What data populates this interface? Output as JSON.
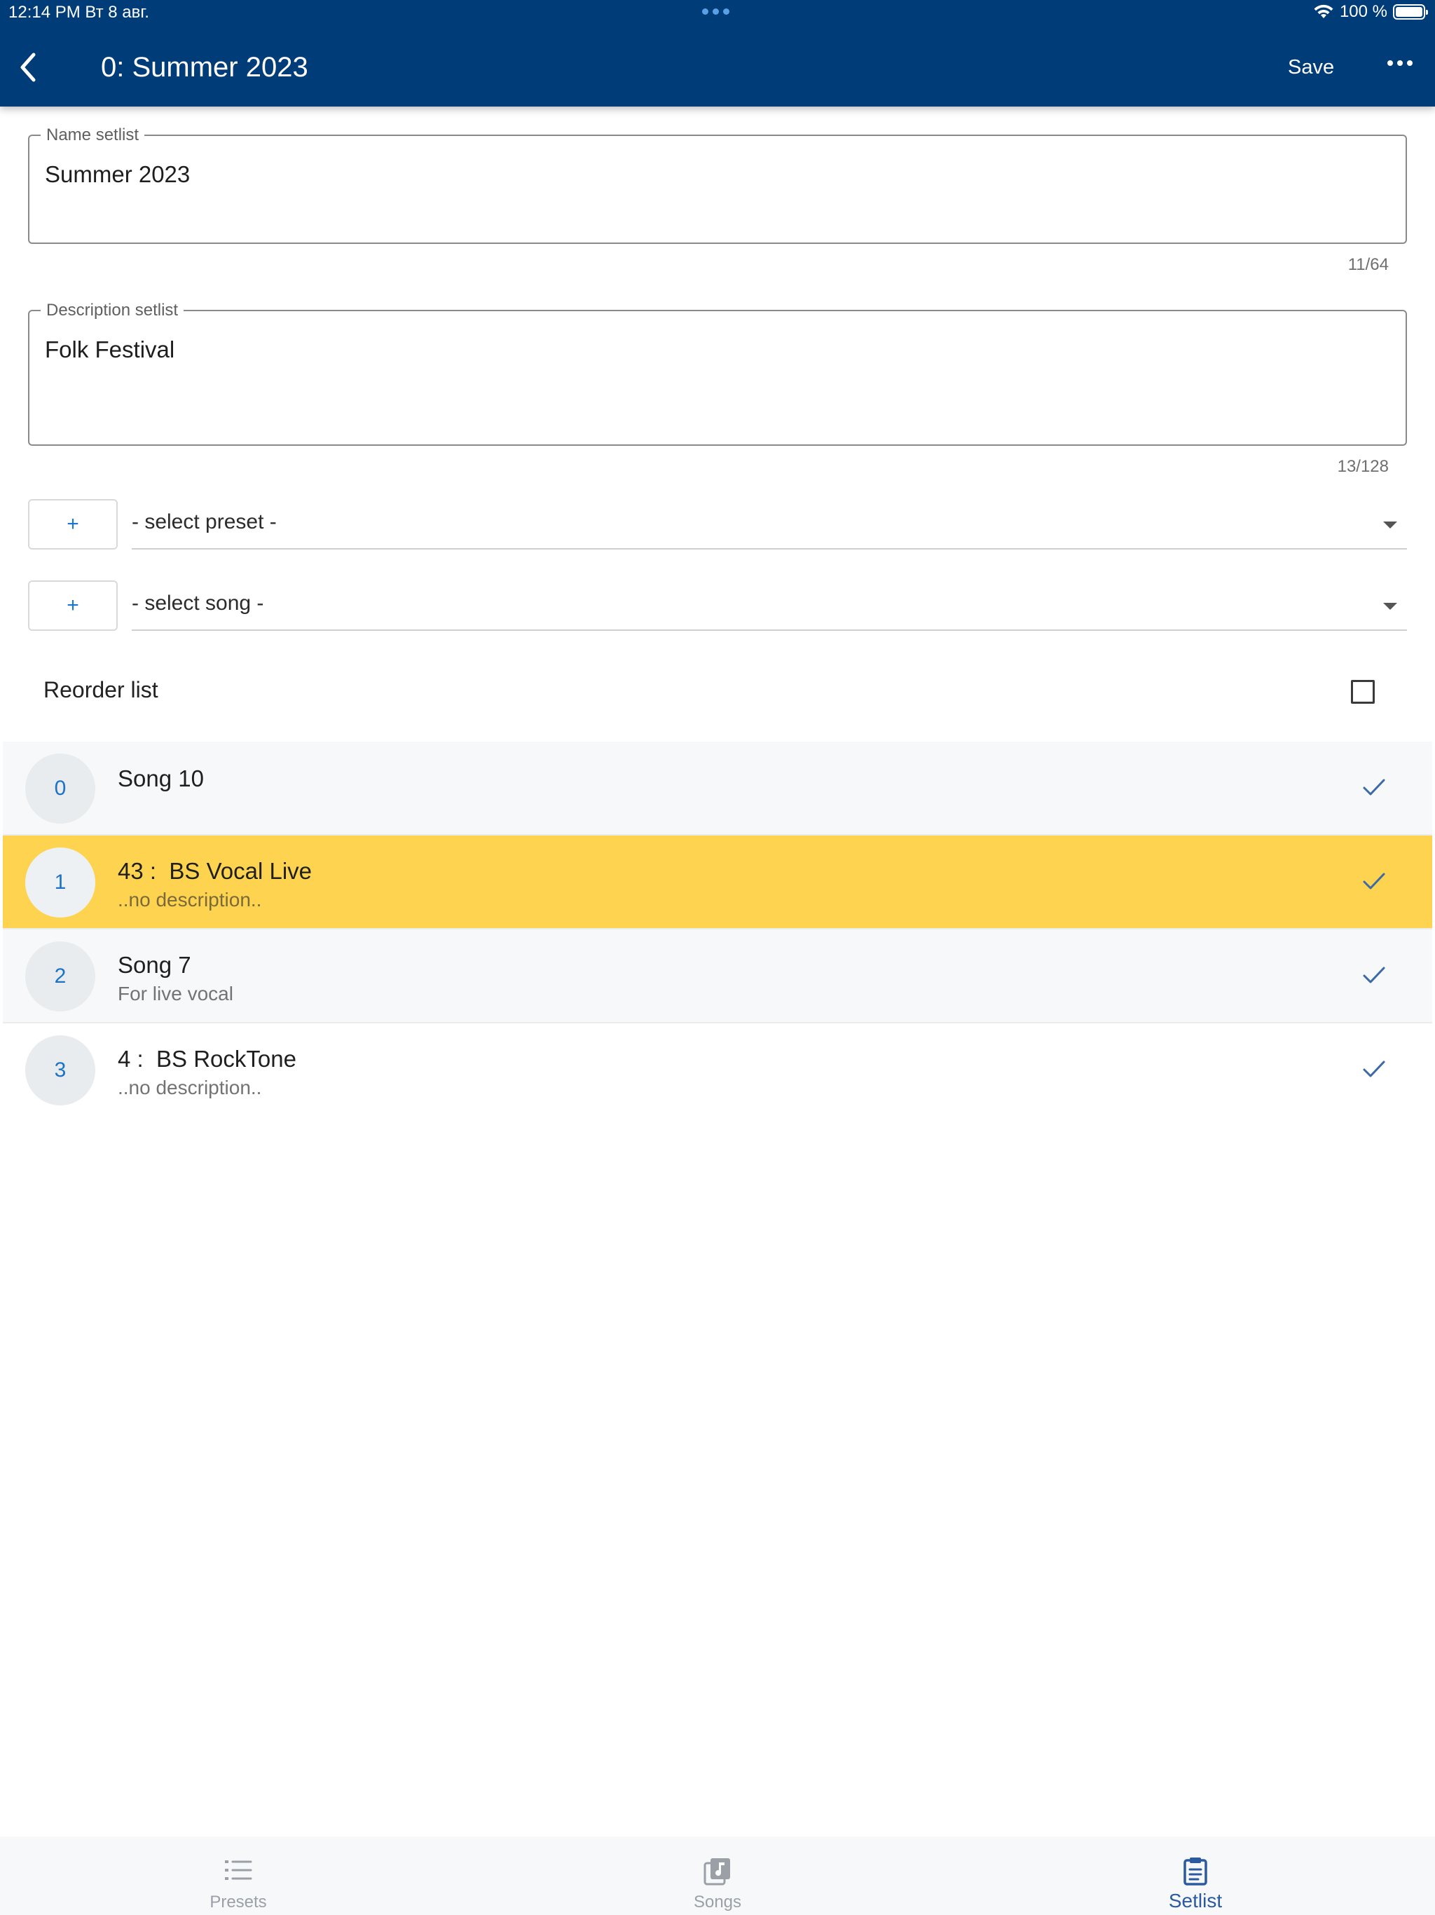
{
  "status_bar": {
    "time_date": "12:14 PM   Вт 8 авг.",
    "battery": "100 %"
  },
  "header": {
    "title": "0: Summer 2023",
    "save_label": "Save"
  },
  "form": {
    "name_label": "Name setlist",
    "name_value": "Summer 2023",
    "name_counter": "11/64",
    "description_label": "Description setlist",
    "description_value": "Folk Festival",
    "description_counter": "13/128",
    "add_label": "+",
    "preset_select": "- select preset -",
    "song_select": "- select song -",
    "reorder_label": "Reorder list",
    "reorder_checked": false
  },
  "setlist": [
    {
      "index": "0",
      "title": "Song 10",
      "subtitle": "",
      "selected": false
    },
    {
      "index": "1",
      "title": "43 :  BS Vocal Live",
      "subtitle": "..no description..",
      "selected": true
    },
    {
      "index": "2",
      "title": "Song 7",
      "subtitle": "For live vocal",
      "selected": false
    },
    {
      "index": "3",
      "title": "4 :  BS RockTone",
      "subtitle": "..no description..",
      "selected": false
    }
  ],
  "tabs": [
    {
      "label": "Presets",
      "icon": "list-icon",
      "active": false
    },
    {
      "label": "Songs",
      "icon": "music-note-icon",
      "active": false
    },
    {
      "label": "Setlist",
      "icon": "clipboard-icon",
      "active": true
    }
  ],
  "colors": {
    "header_bg": "#003c78",
    "selected_row": "#fed34f",
    "accent": "#1976d2"
  }
}
